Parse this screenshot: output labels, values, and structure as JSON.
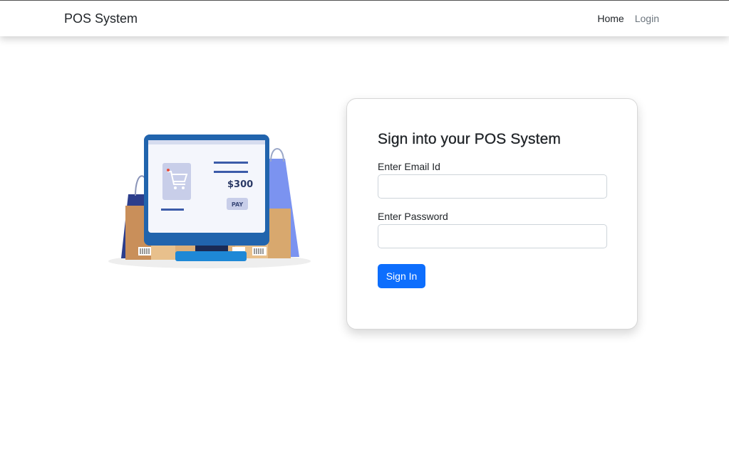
{
  "navbar": {
    "brand": "POS System",
    "links": [
      {
        "label": "Home",
        "active": true
      },
      {
        "label": "Login",
        "active": false
      }
    ]
  },
  "illustration": {
    "icon": "pos-terminal-illustration",
    "price_text": "$300",
    "pay_label": "PAY"
  },
  "login": {
    "title": "Sign into your POS System",
    "email_label": "Enter Email Id",
    "email_value": "",
    "email_placeholder": "",
    "password_label": "Enter Password",
    "password_value": "",
    "password_placeholder": "",
    "submit_label": "Sign In"
  },
  "colors": {
    "primary": "#0d6efd",
    "text": "#212529",
    "muted": "#6c757d",
    "card_border": "#d7d7d7"
  }
}
